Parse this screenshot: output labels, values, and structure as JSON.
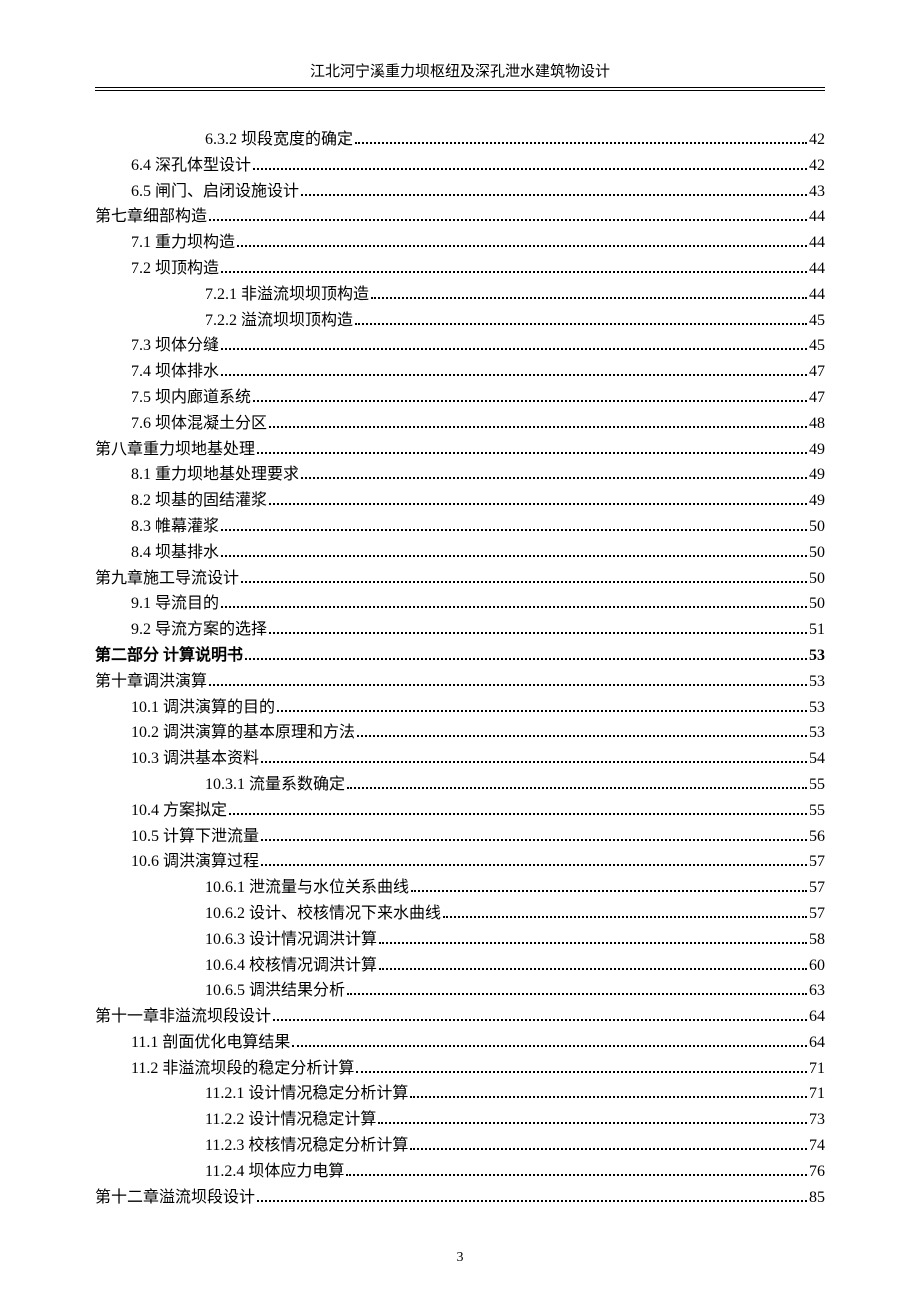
{
  "header": {
    "title": "江北河宁溪重力坝枢纽及深孔泄水建筑物设计"
  },
  "toc": [
    {
      "label": "6.3.2 坝段宽度的确定",
      "page": "42",
      "level": 2
    },
    {
      "label": "6.4 深孔体型设计",
      "page": "42",
      "level": 1
    },
    {
      "label": "6.5 闸门、启闭设施设计",
      "page": "43",
      "level": 1
    },
    {
      "label": "第七章细部构造",
      "page": "44",
      "level": 0
    },
    {
      "label": "7.1 重力坝构造",
      "page": "44",
      "level": 1
    },
    {
      "label": "7.2 坝顶构造",
      "page": "44",
      "level": 1
    },
    {
      "label": "7.2.1 非溢流坝坝顶构造",
      "page": "44",
      "level": 2
    },
    {
      "label": "7.2.2 溢流坝坝顶构造",
      "page": "45",
      "level": 2
    },
    {
      "label": "7.3 坝体分缝",
      "page": "45",
      "level": 1
    },
    {
      "label": "7.4 坝体排水",
      "page": "47",
      "level": 1
    },
    {
      "label": "7.5 坝内廊道系统",
      "page": "47",
      "level": 1
    },
    {
      "label": "7.6 坝体混凝土分区",
      "page": "48",
      "level": 1
    },
    {
      "label": "第八章重力坝地基处理",
      "page": "49",
      "level": 0
    },
    {
      "label": "8.1 重力坝地基处理要求",
      "page": "49",
      "level": 1
    },
    {
      "label": "8.2 坝基的固结灌浆",
      "page": "49",
      "level": 1
    },
    {
      "label": "8.3 帷幕灌浆",
      "page": "50",
      "level": 1
    },
    {
      "label": "8.4 坝基排水",
      "page": "50",
      "level": 1
    },
    {
      "label": "第九章施工导流设计",
      "page": "50",
      "level": 0
    },
    {
      "label": "9.1 导流目的",
      "page": "50",
      "level": 1
    },
    {
      "label": "9.2 导流方案的选择",
      "page": "51",
      "level": 1
    },
    {
      "label": "第二部分  计算说明书",
      "page": "53",
      "level": 0,
      "bold": true
    },
    {
      "label": "第十章调洪演算",
      "page": "53",
      "level": 0
    },
    {
      "label": "10.1 调洪演算的目的",
      "page": "53",
      "level": 1
    },
    {
      "label": "10.2 调洪演算的基本原理和方法",
      "page": "53",
      "level": 1
    },
    {
      "label": "10.3 调洪基本资料",
      "page": "54",
      "level": 1
    },
    {
      "label": "10.3.1 流量系数确定",
      "page": "55",
      "level": 2
    },
    {
      "label": "10.4 方案拟定",
      "page": "55",
      "level": 1
    },
    {
      "label": "10.5 计算下泄流量",
      "page": "56",
      "level": 1
    },
    {
      "label": "10.6 调洪演算过程",
      "page": "57",
      "level": 1
    },
    {
      "label": "10.6.1 泄流量与水位关系曲线",
      "page": "57",
      "level": 2
    },
    {
      "label": "10.6.2 设计、校核情况下来水曲线",
      "page": "57",
      "level": 2
    },
    {
      "label": "10.6.3 设计情况调洪计算",
      "page": "58",
      "level": 2
    },
    {
      "label": "10.6.4 校核情况调洪计算",
      "page": "60",
      "level": 2
    },
    {
      "label": "10.6.5 调洪结果分析",
      "page": "63",
      "level": 2
    },
    {
      "label": "第十一章非溢流坝段设计",
      "page": "64",
      "level": 0
    },
    {
      "label": "11.1 剖面优化电算结果",
      "page": "64",
      "level": 1
    },
    {
      "label": "11.2 非溢流坝段的稳定分析计算",
      "page": "71",
      "level": 1
    },
    {
      "label": "11.2.1 设计情况稳定分析计算",
      "page": "71",
      "level": 2
    },
    {
      "label": "11.2.2 设计情况稳定计算",
      "page": "73",
      "level": 2
    },
    {
      "label": "11.2.3 校核情况稳定分析计算",
      "page": "74",
      "level": 2
    },
    {
      "label": "11.2.4 坝体应力电算",
      "page": "76",
      "level": 2
    },
    {
      "label": "第十二章溢流坝段设计",
      "page": "85",
      "level": 0
    }
  ],
  "footer": {
    "page_number": "3"
  }
}
